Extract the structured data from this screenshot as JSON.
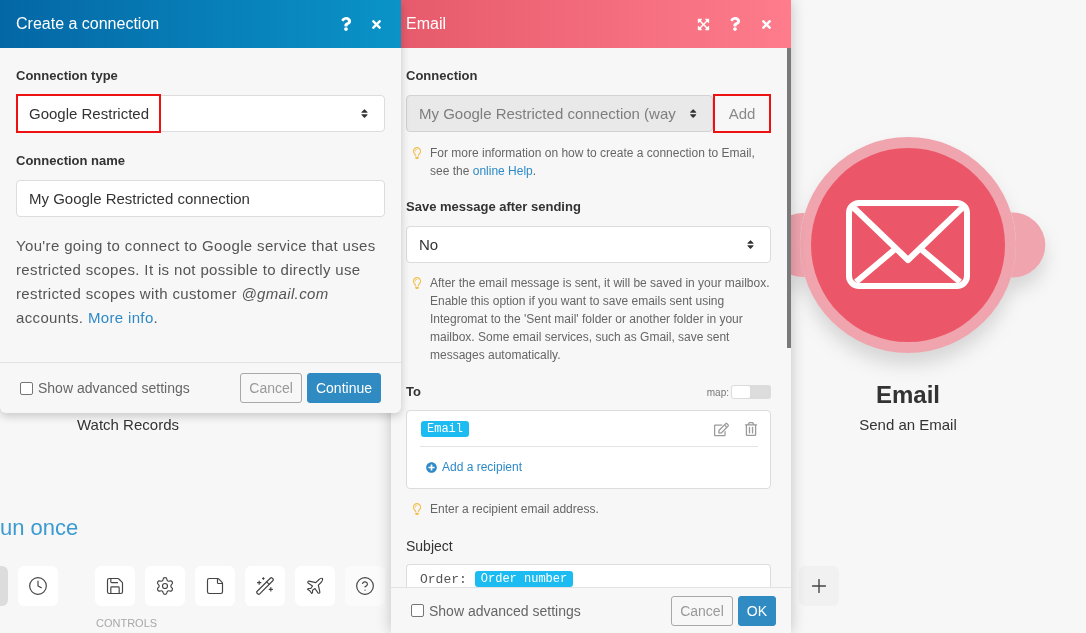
{
  "canvas": {
    "modules": [
      {
        "kind": "trigger",
        "label": "Watch Records"
      },
      {
        "kind": "action",
        "title": "Email",
        "subtitle": "Send an Email"
      }
    ],
    "run_once": "un once",
    "toolbar": {
      "groups": [
        {
          "buttons": [
            {
              "kind": "run"
            },
            {
              "kind": "schedule"
            }
          ]
        },
        {
          "label": "CONTROLS",
          "buttons": [
            {
              "kind": "save"
            },
            {
              "kind": "settings"
            },
            {
              "kind": "notes"
            },
            {
              "kind": "align"
            },
            {
              "kind": "flow"
            },
            {
              "kind": "help"
            }
          ]
        }
      ]
    }
  },
  "connection_dialog": {
    "title": "Create a connection",
    "fields": [
      {
        "kind": "select",
        "label": "Connection type",
        "value": "Google Restricted",
        "highlighted": true
      },
      {
        "kind": "input",
        "label": "Connection name",
        "value": "My Google Restricted connection",
        "highlighted": false
      }
    ],
    "notice": {
      "text": "You're going to connect to Google service that uses restricted scopes. It is not possible to directly use restricted scopes with customer *@gmail.com* accounts.",
      "link": "More info",
      "after_link": "."
    },
    "advanced_settings": {
      "label": "Show advanced settings",
      "checked": false
    },
    "buttons": [
      {
        "kind": "secondary",
        "label": "Cancel"
      },
      {
        "kind": "primary",
        "label": "Continue"
      }
    ]
  },
  "email_panel": {
    "title": "Email",
    "connection": {
      "label": "Connection",
      "value": "My Google Restricted connection (way",
      "disabled": true,
      "add_button": {
        "label": "Add",
        "highlighted": true
      },
      "hint": {
        "text": "For more information on how to create a connection to Email, see the",
        "link": "online Help",
        "after_link": "."
      }
    },
    "save_message": {
      "label": "Save message after sending",
      "value": "No",
      "hint": "After the email message is sent, it will be saved in your mailbox. Enable this option if you want to save emails sent using Integromat to the 'Sent mail' folder or another folder in your mailbox. Some email services, such as Gmail, save sent messages automatically."
    },
    "to": {
      "label": "To",
      "map_label": "map:",
      "map_on": false,
      "recipients": [
        {
          "value": "Email"
        }
      ],
      "add_label": "Add a recipient",
      "hint": "Enter a recipient email address."
    },
    "subject": {
      "label": "Subject",
      "parts": [
        {
          "kind": "text",
          "text": "Order:"
        },
        {
          "kind": "chip",
          "text": "Order number"
        }
      ]
    },
    "advanced_settings": {
      "label": "Show advanced settings",
      "checked": false
    },
    "buttons": [
      {
        "kind": "secondary",
        "label": "Cancel"
      },
      {
        "kind": "primary",
        "label": "OK"
      }
    ]
  }
}
